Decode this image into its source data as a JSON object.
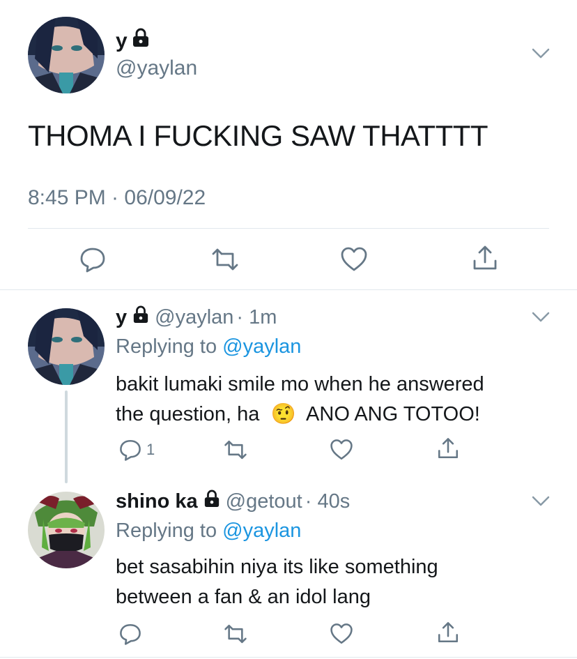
{
  "main_tweet": {
    "display_name": "y",
    "handle": "@yaylan",
    "text": "THOMA I FUCKING SAW THATTTT",
    "timestamp": "8:45 PM · 06/09/22"
  },
  "replies": [
    {
      "display_name": "y",
      "handle": "@yaylan",
      "time": "· 1m",
      "replying_prefix": "Replying to",
      "replying_to": "@yaylan",
      "text_line1": "bakit lumaki smile mo when he answered",
      "text_line2_a": "the question, ha",
      "emoji": "🤨",
      "text_line2_b": "ANO ANG TOTOO!",
      "reply_count": "1"
    },
    {
      "display_name": "shino ka",
      "handle": "@getout",
      "time": "· 40s",
      "replying_prefix": "Replying to",
      "replying_to": "@yaylan",
      "text_line1": "bet sasabihin niya its like something",
      "text_line2": "between a fan & an idol lang"
    }
  ],
  "colors": {
    "link": "#1b95e0",
    "muted": "#657786",
    "divider": "#e1e8ed"
  },
  "icons": [
    "lock-icon",
    "chevron-down-icon",
    "reply-icon",
    "retweet-icon",
    "like-icon",
    "share-icon"
  ]
}
